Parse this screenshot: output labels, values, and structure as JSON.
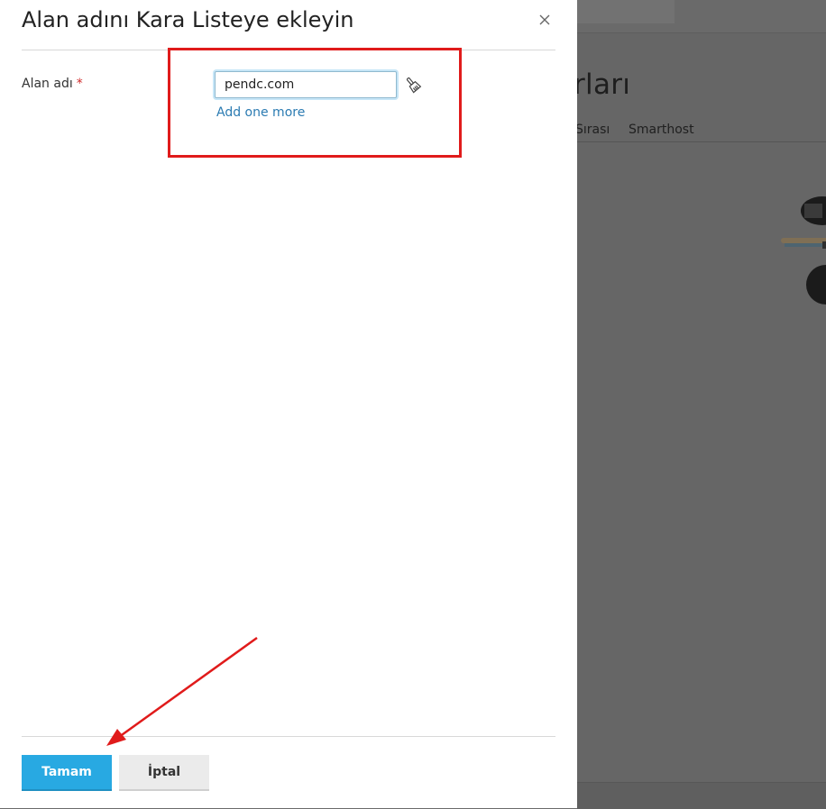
{
  "dialog": {
    "title": "Alan adını Kara Listeye ekleyin",
    "field_label": "Alan adı",
    "required_mark": "*",
    "domain_value": "pendc.com",
    "add_more_label": "Add one more",
    "ok_label": "Tamam",
    "cancel_label": "İptal"
  },
  "background": {
    "title_fragment": "rları",
    "tabs": [
      "Sırası",
      "Smarthost"
    ]
  },
  "icons": {
    "close": "close-icon",
    "clear": "brush-icon"
  },
  "colors": {
    "primary_button": "#28a9e2",
    "annotation_red": "#e01b1b",
    "link": "#2b7bb2",
    "required": "#d02b2b"
  }
}
